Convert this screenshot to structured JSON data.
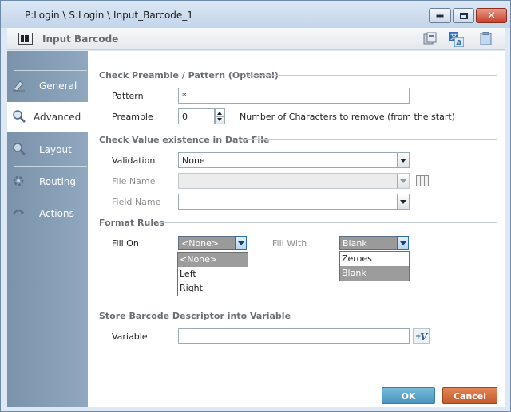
{
  "window": {
    "title": "P:Login \\ S:Login \\ Input_Barcode_1"
  },
  "header": {
    "title": "Input Barcode",
    "icons": [
      "barcode-icon",
      "save-copy-icon",
      "translate-icon",
      "clipboard-icon"
    ]
  },
  "sidebar": {
    "items": [
      {
        "label": "General",
        "icon": "general-icon",
        "active": false
      },
      {
        "label": "Advanced",
        "icon": "advanced-icon",
        "active": true
      },
      {
        "label": "Layout",
        "icon": "layout-icon",
        "active": false
      },
      {
        "label": "Routing",
        "icon": "routing-icon",
        "active": false
      },
      {
        "label": "Actions",
        "icon": "actions-icon",
        "active": false
      }
    ]
  },
  "sections": {
    "pattern": {
      "title": "Check Preamble / Pattern (Optional)",
      "pattern_label": "Pattern",
      "pattern_value": "*",
      "preamble_label": "Preamble",
      "preamble_value": "0",
      "preamble_hint": "Number of Characters to remove (from the start)"
    },
    "validation": {
      "title": "Check Value existence in Data File",
      "validation_label": "Validation",
      "validation_value": "None",
      "file_name_label": "File Name",
      "file_name_value": "",
      "field_name_label": "Field Name",
      "field_name_value": ""
    },
    "format": {
      "title": "Format Rules",
      "fill_on_label": "Fill On",
      "fill_on_value": "<None>",
      "fill_on_options": [
        "<None>",
        "Left",
        "Right"
      ],
      "fill_with_label": "Fill  With",
      "fill_with_value": "Blank",
      "fill_with_options": [
        "Zeroes",
        "Blank"
      ]
    },
    "store": {
      "title": "Store Barcode Descriptor into Variable",
      "variable_label": "Variable",
      "variable_value": "",
      "add_variable_icon": "add-variable-icon"
    }
  },
  "footer": {
    "ok_label": "OK",
    "cancel_label": "Cancel"
  },
  "colors": {
    "sidebar": "#8fa8c0",
    "ok_button": "#4c94bf",
    "cancel_button": "#c4592a",
    "selected_option": "#9c9c9c"
  }
}
